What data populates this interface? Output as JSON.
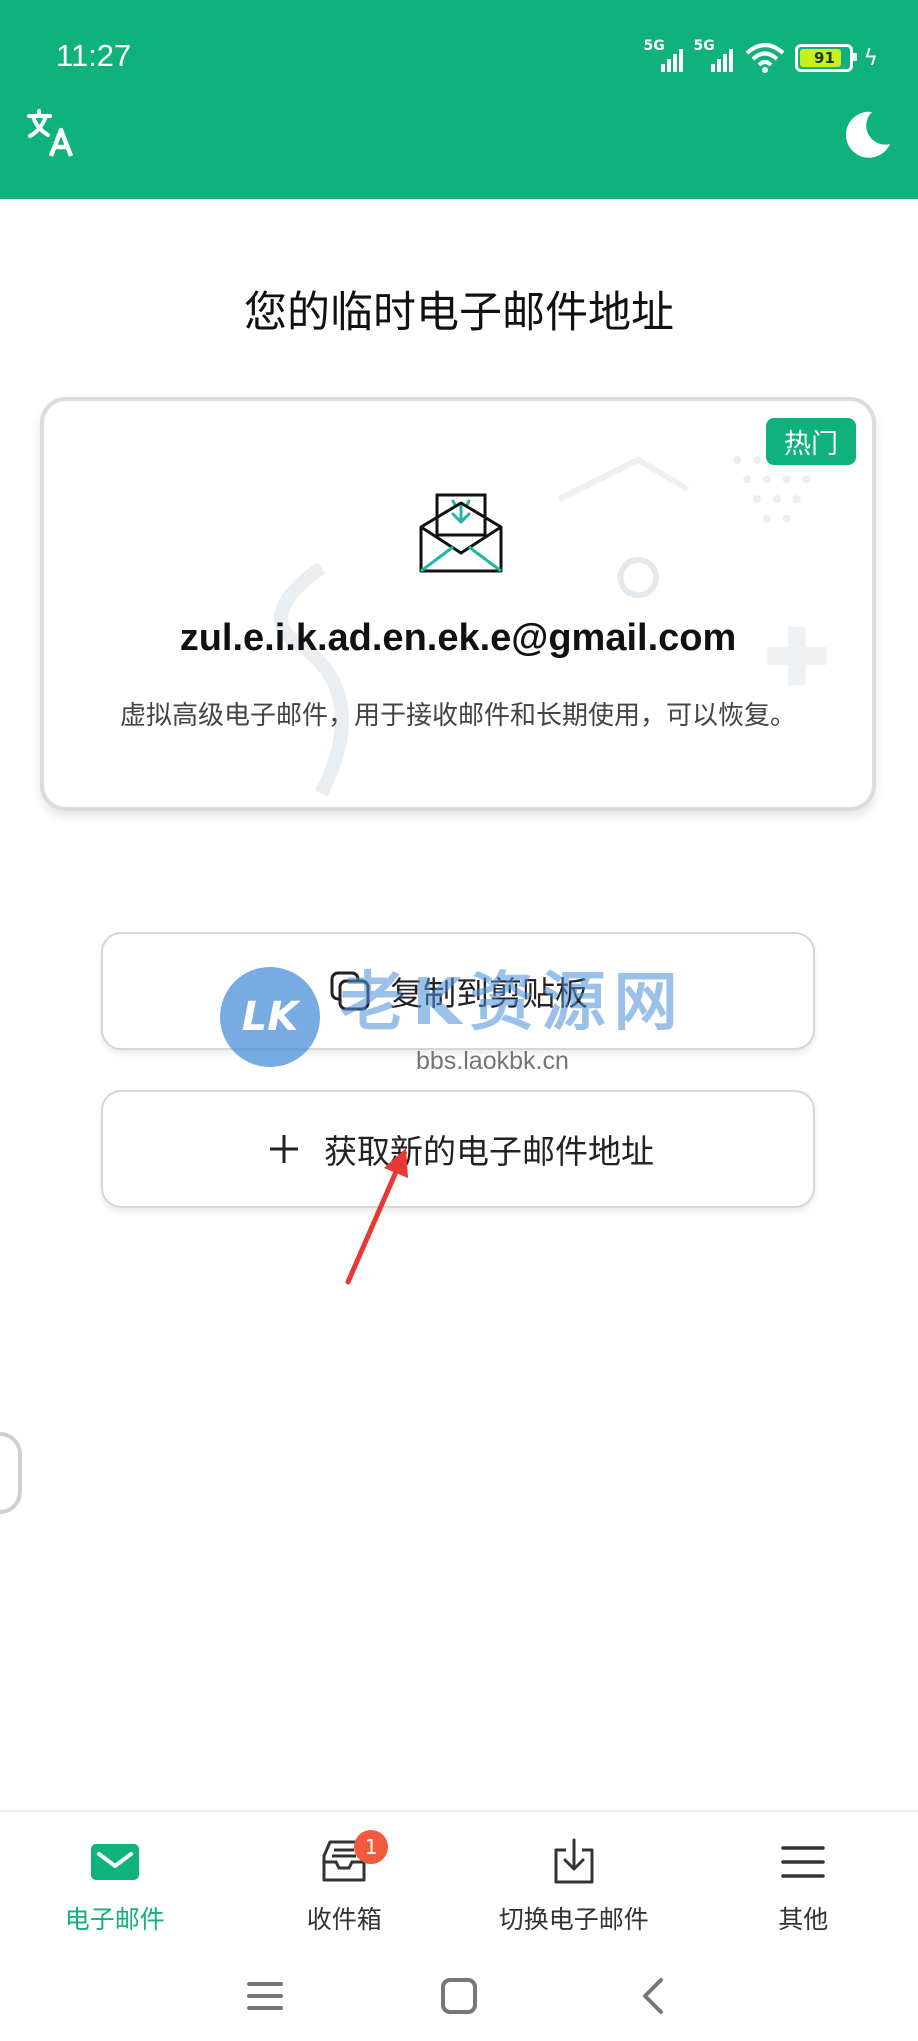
{
  "status_bar": {
    "time": "11:27",
    "network_1": "5G",
    "network_2": "5G",
    "battery": "91"
  },
  "header": {
    "translate_icon": "translate-icon",
    "theme_icon": "moon-icon",
    "brand_color": "#0fb27c"
  },
  "main": {
    "title": "您的临时电子邮件地址",
    "card": {
      "badge": "热门",
      "email": "zul.e.i.k.ad.en.ek.e@gmail.com",
      "description": "虚拟高级电子邮件，用于接收邮件和长期使用，可以恢复。"
    },
    "copy_button": "复制到剪贴板",
    "new_button": "获取新的电子邮件地址"
  },
  "watermark": {
    "logo": "LK",
    "text": "老K资源网",
    "url": "bbs.laokbk.cn"
  },
  "bottom_nav": {
    "items": [
      {
        "label": "电子邮件",
        "icon": "mail-icon",
        "active": true
      },
      {
        "label": "收件箱",
        "icon": "inbox-icon",
        "badge": "1"
      },
      {
        "label": "切换电子邮件",
        "icon": "download-icon"
      },
      {
        "label": "其他",
        "icon": "menu-icon"
      }
    ]
  }
}
